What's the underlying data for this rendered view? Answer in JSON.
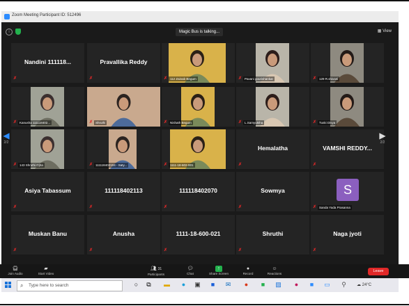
{
  "window": {
    "title": "Zoom Meeting Participant ID: 512496"
  },
  "topbar": {
    "talking_text": "Magic Bus is talking...",
    "view_label": "View"
  },
  "pager": {
    "left_page": "2/2",
    "right_page": "2/2"
  },
  "tiles": [
    {
      "kind": "name",
      "name": "Nandini 111118..."
    },
    {
      "kind": "name",
      "name": "Pravallika Reddy"
    },
    {
      "kind": "video",
      "label": "112 Zainab Begum"
    },
    {
      "kind": "video",
      "label": "Pavani gourishankar"
    },
    {
      "kind": "video",
      "label": "129 R.shivani"
    },
    {
      "kind": "video",
      "label": "Kanusha 111118402..."
    },
    {
      "kind": "video",
      "label": "Shruthi"
    },
    {
      "kind": "video",
      "label": "Nishath Begum"
    },
    {
      "kind": "video",
      "label": "L.Samyuktha"
    },
    {
      "kind": "video",
      "label": "Tuski Divya"
    },
    {
      "kind": "video",
      "label": "143 Shruthi Ojha"
    },
    {
      "kind": "video",
      "label": "111118402104 - Saty..."
    },
    {
      "kind": "video",
      "label": "1111-18-602-001"
    },
    {
      "kind": "name",
      "name": "Hemalatha"
    },
    {
      "kind": "name",
      "name": "VAMSHI REDDY..."
    },
    {
      "kind": "name",
      "name": "Asiya Tabassum"
    },
    {
      "kind": "name",
      "name": "111118402113"
    },
    {
      "kind": "name",
      "name": "111118402070"
    },
    {
      "kind": "name",
      "name": "Sowmya"
    },
    {
      "kind": "avatar",
      "avatar_letter": "S",
      "label": "Sanda Yada Prasanna"
    },
    {
      "kind": "name",
      "name": "Muskan Banu"
    },
    {
      "kind": "name",
      "name": "Anusha"
    },
    {
      "kind": "name",
      "name": "1111-18-600-021"
    },
    {
      "kind": "name",
      "name": "Shruthi"
    },
    {
      "kind": "name",
      "name": "Naga jyoti"
    }
  ],
  "controls": {
    "join_audio": "Join Audio",
    "start_video": "Start Video",
    "participants": "Participants",
    "participants_count": "31",
    "chat": "Chat",
    "share_screen": "Share Screen",
    "record": "Record",
    "reactions": "Reactions",
    "leave": "Leave"
  },
  "taskbar": {
    "search_placeholder": "Type here to search",
    "temperature": "24°C"
  },
  "colors": {
    "accent_blue": "#2d8cff",
    "leave_red": "#e02828",
    "share_green": "#23b14d",
    "avatar_purple": "#8b5fbf"
  }
}
